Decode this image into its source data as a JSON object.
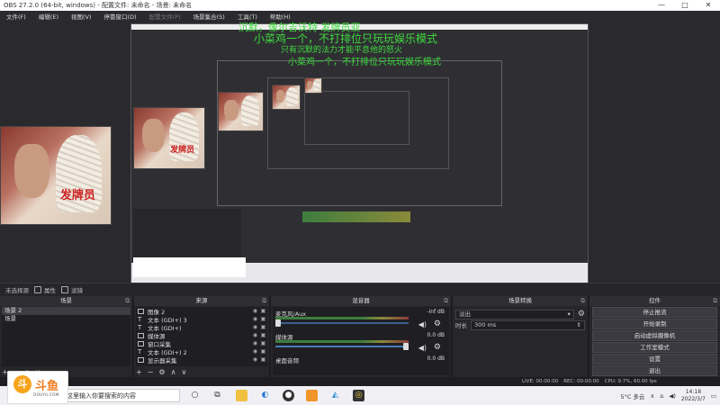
{
  "window": {
    "title": "OBS 27.2.0 (64-bit, windows) - 配置文件: 未命名 - 场景: 未命名",
    "controls": [
      "—",
      "□",
      "✕"
    ]
  },
  "menu": [
    {
      "label": "文件(F)"
    },
    {
      "label": "编辑(E)"
    },
    {
      "label": "视图(V)"
    },
    {
      "label": "停靠窗口(D)"
    },
    {
      "label": "配置文件(P)"
    },
    {
      "label": "场景集合(S)"
    },
    {
      "label": "工具(T)"
    },
    {
      "label": "帮助(H)"
    }
  ],
  "danmaku": [
    {
      "text": "沉默，像尔吉沃特  发牌员亚",
      "color": "#3ddc3d"
    },
    {
      "text": "小菜鸡一个，不打排位只玩玩娱乐模式",
      "color": "#3ddc3d"
    },
    {
      "text": "只有沉默的法力才能平息他的怒火",
      "color": "#3ddc3d"
    },
    {
      "text": "小菜鸡一个，不打排位只玩玩娱乐模式",
      "color": "#3ddc3d"
    }
  ],
  "watermark": "发牌员",
  "status_top": {
    "scene_label": "未选择源",
    "properties": "属性",
    "filters": "滤镜"
  },
  "docks": {
    "scenes": {
      "title": "场景",
      "items": [
        "场景 2",
        "场景"
      ],
      "selected": 0
    },
    "sources": {
      "title": "来源",
      "items": [
        {
          "label": "图像 2",
          "icon": "image-icon"
        },
        {
          "label": "文本 (GDI+) 3",
          "icon": "text-icon"
        },
        {
          "label": "文本 (GDI+)",
          "icon": "text-icon"
        },
        {
          "label": "媒体源",
          "icon": "media-icon"
        },
        {
          "label": "窗口采集",
          "icon": "window-icon"
        },
        {
          "label": "文本 (GDI+) 2",
          "icon": "text-icon"
        },
        {
          "label": "显示器采集",
          "icon": "display-icon"
        }
      ]
    },
    "mixer": {
      "title": "混音器",
      "channels": [
        {
          "name": "麦克风/Aux",
          "db": "-inf dB"
        },
        {
          "name": "媒体源",
          "db": "0.0 dB"
        },
        {
          "name": "桌面音频",
          "db": "0.0 dB"
        }
      ]
    },
    "transitions": {
      "title": "场景转换",
      "selected": "淡出",
      "duration_label": "时长",
      "duration_value": "300 ms"
    },
    "controls": {
      "title": "控件",
      "buttons": [
        "停止推流",
        "开始录制",
        "启动虚拟摄像机",
        "工作室模式",
        "设置",
        "退出"
      ]
    }
  },
  "obs_status": {
    "live": "LIVE: 00:00:00",
    "rec": "REC: 00:00:00",
    "cpu": "CPU: 9.7%, 60.00 fps"
  },
  "douyu": {
    "logo_char": "斗",
    "name": "斗鱼",
    "sub": "DOUYU.COM"
  },
  "taskbar": {
    "search_placeholder": "在这里输入你要搜索的内容",
    "weather": "5°C 多云",
    "time": "14:18",
    "date": "2022/3/7"
  }
}
